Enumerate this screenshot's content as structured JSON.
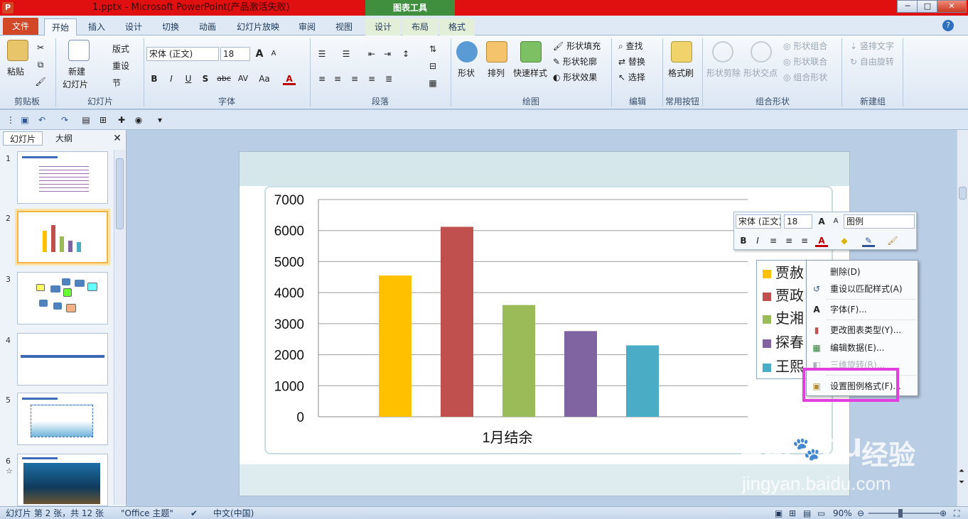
{
  "window": {
    "title": "1.pptx - Microsoft PowerPoint(产品激活失败)",
    "context_tool": "图表工具",
    "minimize": "─",
    "maximize": "□",
    "close": "✕"
  },
  "tabs": [
    "文件",
    "开始",
    "插入",
    "设计",
    "切换",
    "动画",
    "幻灯片放映",
    "审阅",
    "视图",
    "设计",
    "布局",
    "格式"
  ],
  "ribbon": {
    "clipboard": {
      "label": "剪贴板",
      "paste": "粘贴"
    },
    "slides": {
      "label": "幻灯片",
      "new_slide": "新建",
      "new_slide2": "幻灯片",
      "layout": "版式",
      "reset": "重设",
      "section": "节"
    },
    "font": {
      "label": "字体",
      "font_name": "宋体 (正文)",
      "font_size": "18",
      "bold": "B",
      "italic": "I",
      "underline": "U",
      "shadow": "S",
      "strike": "abc",
      "spacing": "AV",
      "case": "Aa",
      "color": "A",
      "grow": "A",
      "shrink": "A"
    },
    "paragraph": {
      "label": "段落"
    },
    "drawing": {
      "label": "绘图",
      "shapes": "形状",
      "arrange": "排列",
      "quick_styles": "快速样式",
      "fill": "形状填充",
      "outline": "形状轮廓",
      "effects": "形状效果"
    },
    "editing": {
      "label": "编辑",
      "find": "查找",
      "replace": "替换",
      "select": "选择"
    },
    "common": {
      "label": "常用按钮",
      "format_painter": "格式刷"
    },
    "shape_combine": {
      "label": "组合形状",
      "clip": "形状剪除",
      "intersect": "形状交点",
      "combine": "形状组合",
      "union": "形状联合",
      "group": "组合形状"
    },
    "new_group": {
      "label": "新建组",
      "vertical_text": "竖排文字",
      "free_rotate": "自由旋转"
    }
  },
  "left_pane": {
    "tab_slides": "幻灯片",
    "tab_outline": "大纲",
    "close": "✕",
    "slide_numbers": [
      "1",
      "2",
      "3",
      "4",
      "5",
      "6"
    ]
  },
  "chart_data": {
    "type": "bar",
    "categories": [
      "1月结余"
    ],
    "series": [
      {
        "name": "贾赦",
        "values": [
          4550
        ],
        "color": "#ffc000"
      },
      {
        "name": "贾政",
        "values": [
          6120
        ],
        "color": "#c0504d"
      },
      {
        "name": "史湘",
        "values": [
          3600
        ],
        "color": "#9bbb59"
      },
      {
        "name": "探春",
        "values": [
          2760
        ],
        "color": "#8064a2"
      },
      {
        "name": "王熙",
        "values": [
          2300
        ],
        "color": "#4bacc6"
      }
    ],
    "y_ticks": [
      "7000",
      "6000",
      "5000",
      "4000",
      "3000",
      "2000",
      "1000",
      "0"
    ],
    "ylim": [
      0,
      7000
    ],
    "grid": true,
    "legend": "right"
  },
  "mini_toolbar": {
    "font": "宋体 (正文)",
    "size": "18",
    "element": "图例",
    "bold": "B",
    "italic": "I"
  },
  "context_menu": {
    "items": [
      {
        "label": "删除(D)",
        "enabled": true
      },
      {
        "label": "重设以匹配样式(A)",
        "enabled": true
      },
      {
        "label": "字体(F)...",
        "enabled": true
      },
      {
        "label": "更改图表类型(Y)...",
        "enabled": true
      },
      {
        "label": "编辑数据(E)...",
        "enabled": true
      },
      {
        "label": "三维旋转(R)...",
        "enabled": false
      },
      {
        "label": "设置图例格式(F)...",
        "enabled": true
      }
    ]
  },
  "status": {
    "slide": "幻灯片 第 2 张，共 12 张",
    "theme": "\"Office 主题\"",
    "language": "中文(中国)",
    "zoom": "90%"
  },
  "watermark": {
    "brand": "Bai",
    "brand2": "du",
    "cn": "经验",
    "url": "jingyan.baidu.com"
  }
}
